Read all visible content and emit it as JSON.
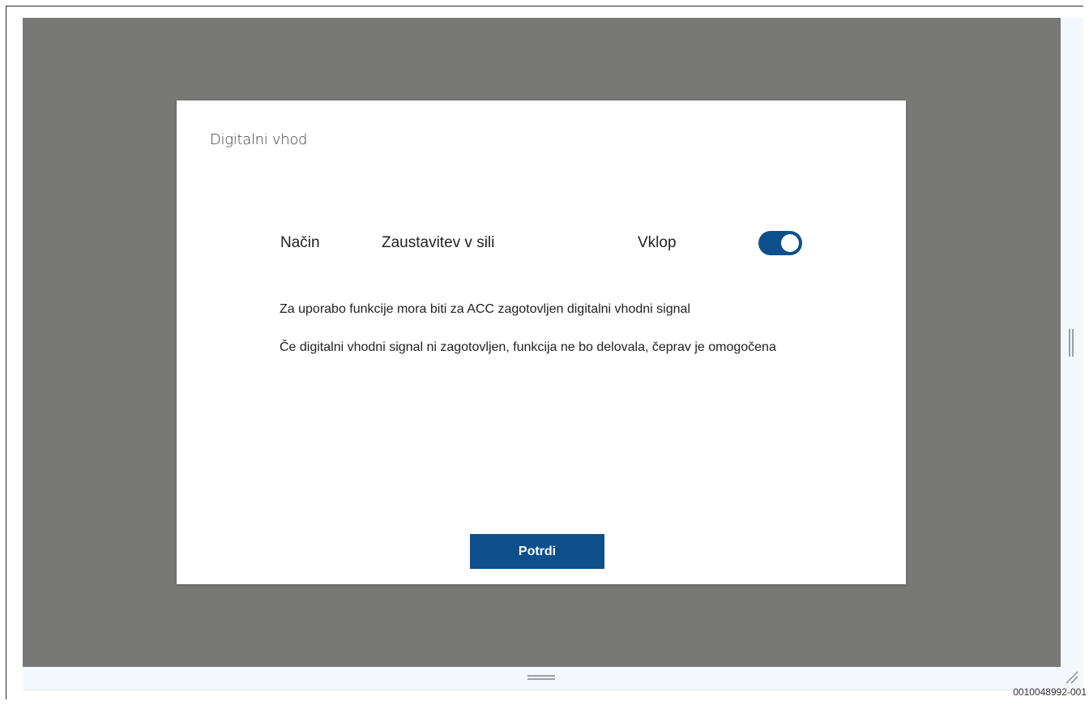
{
  "dialog": {
    "title": "Digitalni vhod",
    "mode_label": "Način",
    "mode_value": "Zaustavitev v sili",
    "state_label": "Vklop",
    "toggle_on": true,
    "info_line_1": "Za uporabo funkcije mora biti za ACC zagotovljen digitalni vhodni signal",
    "info_line_2": "Če digitalni vhodni signal ni zagotovljen, funkcija ne bo delovala, čeprav je omogočena",
    "confirm_label": "Potrdi"
  },
  "figure_id": "0010048992-001",
  "colors": {
    "accent": "#0d4f8b",
    "overlay": "#787876",
    "dialog_bg": "#ffffff"
  },
  "icons": {
    "toggle": "toggle-switch-on-icon",
    "vertical_resize": "vertical-resize-handle-icon",
    "horizontal_resize": "horizontal-resize-handle-icon",
    "corner_resize": "corner-resize-grip-icon"
  }
}
